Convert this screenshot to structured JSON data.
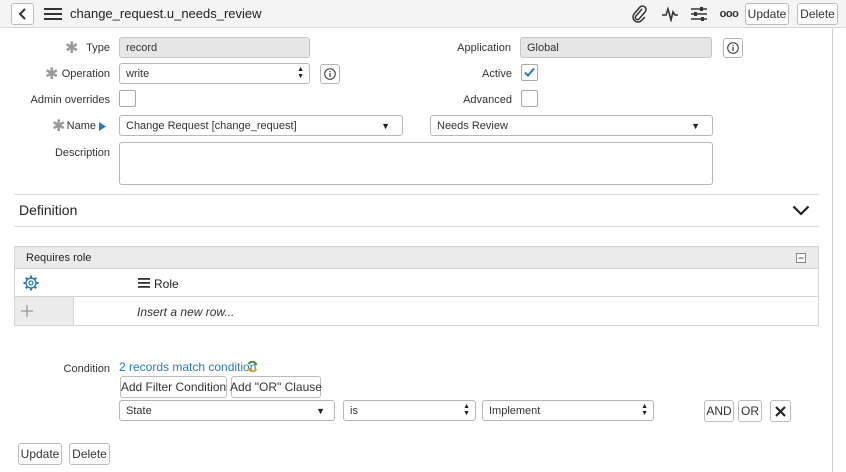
{
  "header": {
    "title": "change_request.u_needs_review",
    "update_label": "Update",
    "delete_label": "Delete",
    "more_label": "ooo"
  },
  "form": {
    "type": {
      "label": "Type",
      "value": "record"
    },
    "application": {
      "label": "Application",
      "value": "Global"
    },
    "operation": {
      "label": "Operation",
      "value": "write"
    },
    "active": {
      "label": "Active",
      "checked": true
    },
    "admin_overrides": {
      "label": "Admin overrides",
      "checked": false
    },
    "advanced": {
      "label": "Advanced",
      "checked": false
    },
    "name": {
      "label": "Name",
      "table_value": "Change Request [change_request]",
      "field_value": "Needs Review"
    },
    "description": {
      "label": "Description",
      "value": ""
    }
  },
  "definition": {
    "title": "Definition"
  },
  "requires_role": {
    "title": "Requires role",
    "column_header": "Role",
    "insert_placeholder": "Insert a new row..."
  },
  "condition": {
    "label": "Condition",
    "match_text": "2 records match condition",
    "add_filter_label": "Add Filter Condition",
    "add_or_label": "Add \"OR\" Clause",
    "field": "State",
    "operator": "is",
    "value": "Implement",
    "and_label": "AND",
    "or_label": "OR"
  },
  "footer": {
    "update_label": "Update",
    "delete_label": "Delete"
  },
  "colors": {
    "accent": "#2b7bb9",
    "header_bg": "#f4f4f4"
  }
}
